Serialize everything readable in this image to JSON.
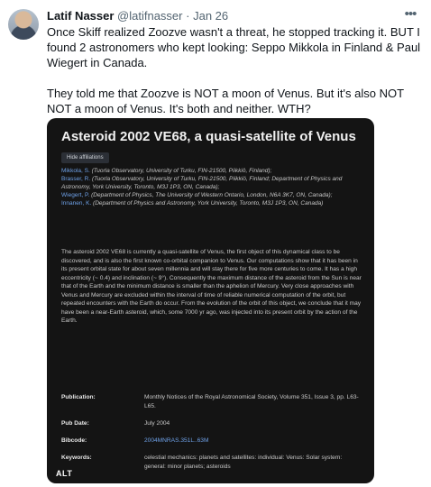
{
  "tweet": {
    "author_name": "Latif Nasser",
    "handle": "@latifnasser",
    "separator": "·",
    "date": "Jan 26",
    "more_icon": "more-horizontal-icon",
    "paragraphs": [
      "Once Skiff realized Zoozve wasn't a threat, he stopped tracking it. BUT I found 2 astronomers who kept looking: Seppo Mikkola in Finland & Paul Wiegert in Canada.",
      "They told me that Zoozve is NOT a moon of Venus. But it's also NOT NOT a moon of Venus. It's both and neither. WTH?"
    ]
  },
  "paper": {
    "title": "Asteroid 2002 VE68, a quasi-satellite of Venus",
    "hide_affiliations": "Hide affiliations",
    "affiliations": [
      {
        "author": "Mikkola, S.",
        "text": " (Tuorla Observatory, University of Turku, FIN-21500, Piikkiö, Finland);"
      },
      {
        "author": "Brasser, R.",
        "text": " (Tuorla Observatory, University of Turku, FIN-21500, Piikkiö, Finland; Department of Physics and Astronomy, York University, Toronto, M3J 1P3, ON, Canada);"
      },
      {
        "author": "Wiegert, P.",
        "text": " (Department of Physics, The University of Western Ontario, London, N6A 3K7, ON, Canada);"
      },
      {
        "author": "Innanen, K.",
        "text": " (Department of Physics and Astronomy, York University, Toronto, M3J 1P3, ON, Canada)"
      }
    ],
    "abstract": "The asteroid 2002 VE68 is currently a quasi-satellite of Venus, the first object of this dynamical class to be discovered, and is also the first known co-orbital companion to Venus. Our computations show that it has been in its present orbital state for about seven millennia and will stay there for five more centuries to come. It has a high eccentricity (~ 0.4) and inclination (~ 9°). Consequently the maximum distance of the asteroid from the Sun is near that of the Earth and the minimum distance is smaller than the aphelion of Mercury. Very close approaches with Venus and Mercury are excluded within the interval of time of reliable numerical computation of the orbit, but repeated encounters with the Earth do occur. From the evolution of the orbit of this object, we conclude that it may have been a near-Earth asteroid, which, some 7000 yr ago, was injected into its present orbit by the action of the Earth.",
    "publication_label": "Publication:",
    "publication_value": "Monthly Notices of the Royal Astronomical Society, Volume 351, Issue 3, pp. L63-L65.",
    "pubdate_label": "Pub Date:",
    "pubdate_value": "July 2004",
    "bibcode_label": "Bibcode:",
    "bibcode_value": "2004MNRAS.351L..63M",
    "keywords_label": "Keywords:",
    "keywords_value": "celestial mechanics: planets and satellites: individual: Venus: Solar system: general: minor planets; asteroids",
    "alt_badge": "ALT"
  }
}
